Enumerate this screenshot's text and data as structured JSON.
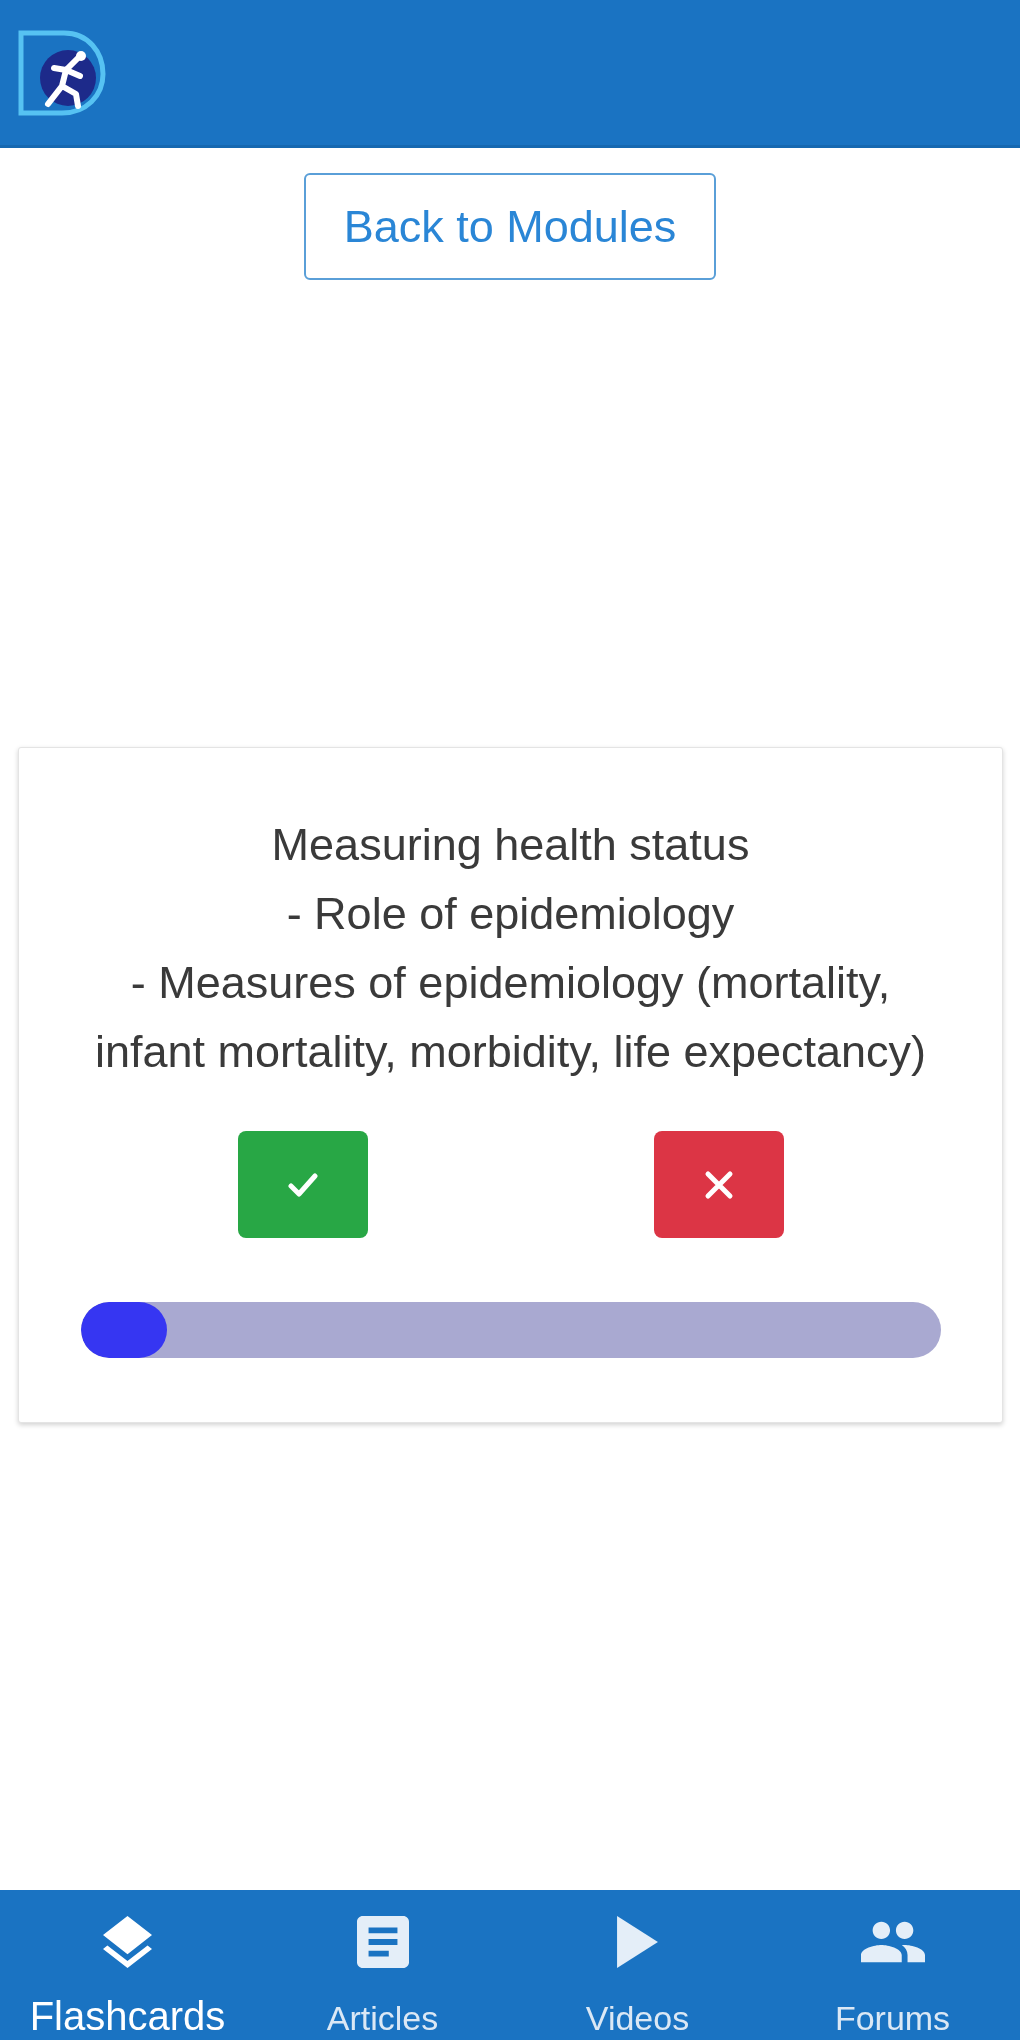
{
  "back_button": {
    "label": "Back to Modules"
  },
  "flashcard": {
    "lines": [
      "Measuring health status",
      "- Role of epidemiology",
      "- Measures of epidemiology (mortality, infant mortality, morbidity, life expectancy)"
    ],
    "answer_buttons": [
      {
        "kind": "correct"
      },
      {
        "kind": "wrong"
      }
    ],
    "progress": {
      "level": 0.1
    }
  },
  "bottom_nav": [
    {
      "label": "Flashcards",
      "selected": true
    },
    {
      "label": "Articles",
      "selected": false
    },
    {
      "label": "Videos",
      "selected": false
    },
    {
      "label": "Forums",
      "selected": false
    }
  ]
}
